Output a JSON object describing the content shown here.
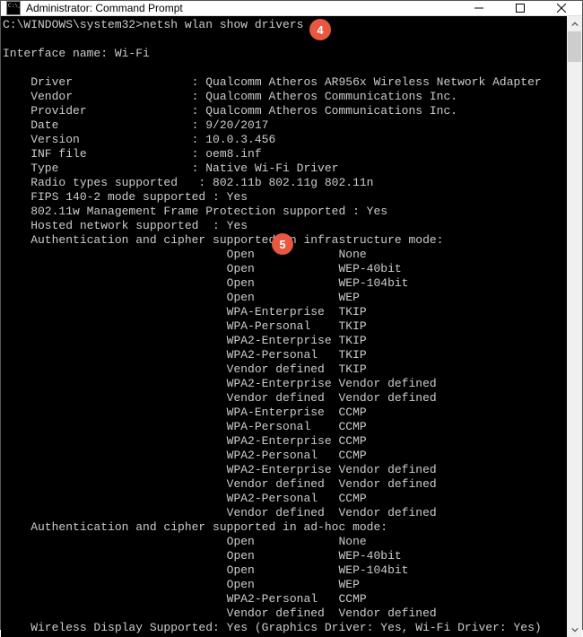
{
  "window": {
    "title": "Administrator: Command Prompt"
  },
  "prompt": {
    "path": "C:\\WINDOWS\\system32>",
    "command": "netsh wlan show drivers"
  },
  "interface_label": "Interface name:",
  "interface_name": "Wi-Fi",
  "kv": {
    "driver_k": "Driver",
    "driver_v": "Qualcomm Atheros AR956x Wireless Network Adapter",
    "vendor_k": "Vendor",
    "vendor_v": "Qualcomm Atheros Communications Inc.",
    "provider_k": "Provider",
    "provider_v": "Qualcomm Atheros Communications Inc.",
    "date_k": "Date",
    "date_v": "9/20/2017",
    "version_k": "Version",
    "version_v": "10.0.3.456",
    "inf_k": "INF file",
    "inf_v": "oem8.inf",
    "type_k": "Type",
    "type_v": "Native Wi-Fi Driver",
    "radio_k": "Radio types supported",
    "radio_v": "802.11b 802.11g 802.11n",
    "fips_k": "FIPS 140-2 mode supported",
    "fips_v": "Yes",
    "mgmt_line": "802.11w Management Frame Protection supported : Yes",
    "hosted_k": "Hosted network supported",
    "hosted_v": "Yes",
    "authinf_k": "Authentication and cipher supported in infrastructure mode:",
    "authadhoc_k": "Authentication and cipher supported in ad-hoc mode:",
    "wireless_line": "Wireless Display Supported: Yes (Graphics Driver: Yes, Wi-Fi Driver: Yes)"
  },
  "ciphers_infra": [
    {
      "a": "Open",
      "c": "None"
    },
    {
      "a": "Open",
      "c": "WEP-40bit"
    },
    {
      "a": "Open",
      "c": "WEP-104bit"
    },
    {
      "a": "Open",
      "c": "WEP"
    },
    {
      "a": "WPA-Enterprise",
      "c": "TKIP"
    },
    {
      "a": "WPA-Personal",
      "c": "TKIP"
    },
    {
      "a": "WPA2-Enterprise",
      "c": "TKIP"
    },
    {
      "a": "WPA2-Personal",
      "c": "TKIP"
    },
    {
      "a": "Vendor defined",
      "c": "TKIP"
    },
    {
      "a": "WPA2-Enterprise",
      "c": "Vendor defined"
    },
    {
      "a": "Vendor defined",
      "c": "Vendor defined"
    },
    {
      "a": "WPA-Enterprise",
      "c": "CCMP"
    },
    {
      "a": "WPA-Personal",
      "c": "CCMP"
    },
    {
      "a": "WPA2-Enterprise",
      "c": "CCMP"
    },
    {
      "a": "WPA2-Personal",
      "c": "CCMP"
    },
    {
      "a": "WPA2-Enterprise",
      "c": "Vendor defined"
    },
    {
      "a": "Vendor defined",
      "c": "Vendor defined"
    },
    {
      "a": "WPA2-Personal",
      "c": "CCMP"
    },
    {
      "a": "Vendor defined",
      "c": "Vendor defined"
    }
  ],
  "ciphers_adhoc": [
    {
      "a": "Open",
      "c": "None"
    },
    {
      "a": "Open",
      "c": "WEP-40bit"
    },
    {
      "a": "Open",
      "c": "WEP-104bit"
    },
    {
      "a": "Open",
      "c": "WEP"
    },
    {
      "a": "WPA2-Personal",
      "c": "CCMP"
    },
    {
      "a": "Vendor defined",
      "c": "Vendor defined"
    }
  ],
  "callouts": {
    "c4": "4",
    "c5": "5"
  }
}
